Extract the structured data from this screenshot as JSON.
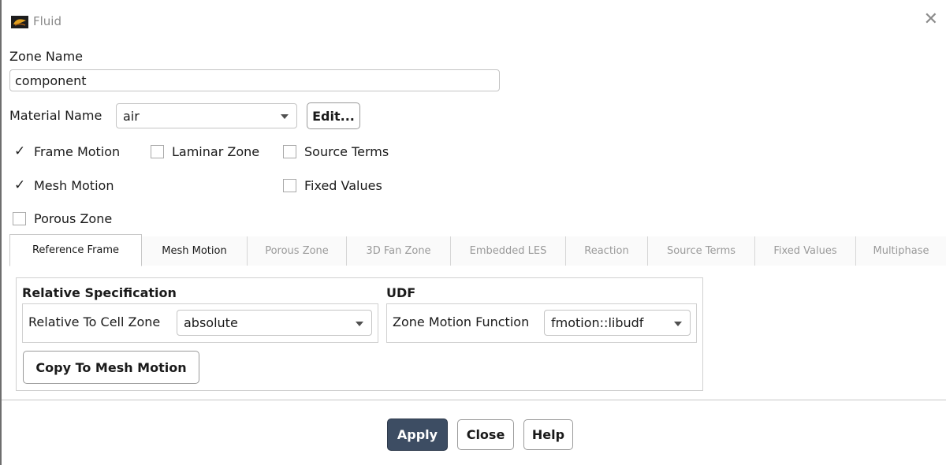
{
  "window": {
    "title": "Fluid"
  },
  "zone": {
    "label": "Zone Name",
    "value": "component"
  },
  "material": {
    "label": "Material Name",
    "value": "air",
    "edit_label": "Edit..."
  },
  "options": {
    "frame_motion": {
      "label": "Frame Motion",
      "checked": true
    },
    "laminar_zone": {
      "label": "Laminar Zone",
      "checked": false
    },
    "source_terms": {
      "label": "Source Terms",
      "checked": false
    },
    "mesh_motion": {
      "label": "Mesh Motion",
      "checked": true
    },
    "fixed_values": {
      "label": "Fixed Values",
      "checked": false
    },
    "porous_zone": {
      "label": "Porous Zone",
      "checked": false
    }
  },
  "tabs": [
    {
      "label": "Reference Frame",
      "state": "active"
    },
    {
      "label": "Mesh Motion",
      "state": "enabled"
    },
    {
      "label": "Porous Zone",
      "state": "disabled"
    },
    {
      "label": "3D Fan Zone",
      "state": "disabled"
    },
    {
      "label": "Embedded LES",
      "state": "disabled"
    },
    {
      "label": "Reaction",
      "state": "disabled"
    },
    {
      "label": "Source Terms",
      "state": "disabled"
    },
    {
      "label": "Fixed Values",
      "state": "disabled"
    },
    {
      "label": "Multiphase",
      "state": "disabled"
    }
  ],
  "relative": {
    "title": "Relative Specification",
    "field_label": "Relative To Cell Zone",
    "value": "absolute",
    "copy_label": "Copy To Mesh Motion"
  },
  "udf": {
    "title": "UDF",
    "field_label": "Zone Motion Function",
    "value": "fmotion::libudf"
  },
  "footer": {
    "apply": "Apply",
    "close": "Close",
    "help": "Help"
  },
  "colors": {
    "primary_button": "#3d4d63",
    "disabled_tab_text": "#9a9a9a"
  },
  "icons": [
    "fluent-app-icon",
    "close-icon",
    "dropdown-arrow-icon",
    "checkmark-icon"
  ]
}
